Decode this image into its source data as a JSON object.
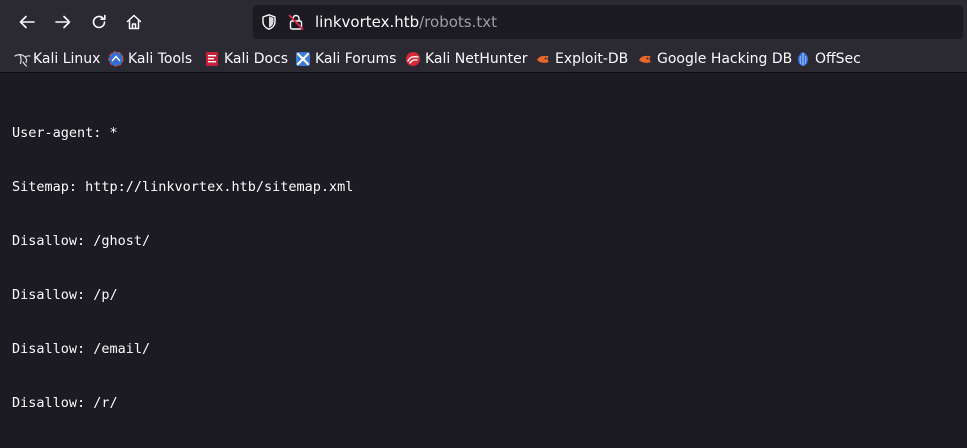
{
  "urlbar": {
    "host": "linkvortex.htb",
    "path": "/robots.txt"
  },
  "bookmarks": [
    {
      "label": "Kali Linux",
      "icon": "kali-dragon-icon"
    },
    {
      "label": "Kali Tools",
      "icon": "kali-tools-icon"
    },
    {
      "label": "Kali Docs",
      "icon": "kali-docs-icon"
    },
    {
      "label": "Kali Forums",
      "icon": "kali-forums-icon"
    },
    {
      "label": "Kali NetHunter",
      "icon": "nethunter-icon"
    },
    {
      "label": "Exploit-DB",
      "icon": "exploit-db-icon"
    },
    {
      "label": "Google Hacking DB",
      "icon": "ghdb-icon"
    },
    {
      "label": "OffSec",
      "icon": "offsec-icon"
    }
  ],
  "robots_txt": {
    "lines": [
      "User-agent: *",
      "Sitemap: http://linkvortex.htb/sitemap.xml",
      "Disallow: /ghost/",
      "Disallow: /p/",
      "Disallow: /email/",
      "Disallow: /r/"
    ]
  },
  "colors": {
    "toolbar_bg": "#2b2a33",
    "page_bg": "#1c1b22",
    "text": "#fbfbfe",
    "url_path": "#9e9ea6",
    "lock_slash": "#e22850"
  }
}
